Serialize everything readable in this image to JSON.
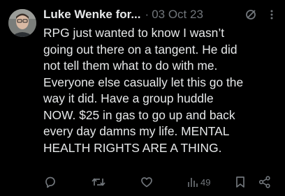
{
  "tweet": {
    "author_name": "Luke Wenke for...",
    "separator": "·",
    "date": "03 Oct 23",
    "text": "RPG just wanted to know I wasn’t\ngoing out there on a tangent.  He did\nnot tell them what to do with me.\nEveryone else casually let this go the\nway it did.  Have a group huddle\nNOW.  $25 in gas to go up and back\nevery day damns my life.  MENTAL\nHEALTH RIGHTS ARE A THING.",
    "views": "49"
  },
  "icons": {
    "header": [
      "slash-circle-icon",
      "more-vertical-icon"
    ],
    "actions": [
      "reply-icon",
      "retweet-icon",
      "like-icon",
      "views-icon",
      "bookmark-icon",
      "share-icon"
    ]
  },
  "colors": {
    "background": "#000000",
    "text": "#e7e9ea",
    "muted": "#71767b"
  }
}
